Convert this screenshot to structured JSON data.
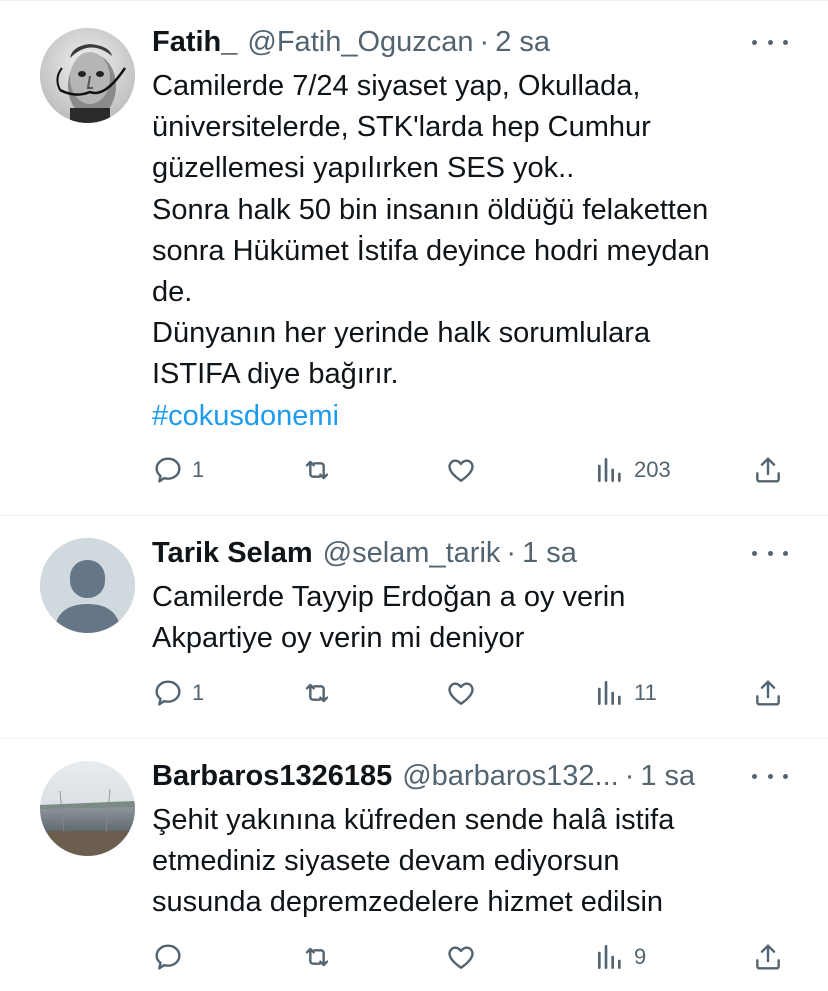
{
  "tweets": [
    {
      "name": "Fatih_",
      "handle": "@Fatih_Oguzcan",
      "dot": "·",
      "time": "2 sa",
      "avatar": "portrait-avatar",
      "lines": [
        "Camilerde 7/24 siyaset yap, Okullada,",
        "üniversitelerde, STK'larda hep Cumhur",
        "güzellemesi yapılırken SES yok..",
        "Sonra halk 50 bin insanın öldüğü felaketten",
        "sonra Hükümet İstifa deyince hodri meydan",
        "de.",
        "Dünyanın her yerinde halk sorumlulara",
        "ISTIFA diye bağırır."
      ],
      "hashtag": "#cokusdonemi",
      "replies": "1",
      "retweets": "",
      "likes": "",
      "views": "203"
    },
    {
      "name": "Tarik Selam",
      "handle": "@selam_tarik",
      "dot": "·",
      "time": "1 sa",
      "avatar": "default-avatar",
      "lines": [
        "Camilerde Tayyip Erdoğan a oy verin",
        "Akpartiye oy verin mi deniyor"
      ],
      "replies": "1",
      "retweets": "",
      "likes": "",
      "views": "11"
    },
    {
      "name": "Barbaros1326185",
      "handle": "@barbaros132...",
      "dot": "·",
      "time": "1 sa",
      "avatar": "landscape-avatar",
      "lines": [
        "Şehit yakınına küfreden sende halâ istifa",
        "etmediniz siyasete devam ediyorsun",
        "susunda depremzedelere hizmet edilsin"
      ],
      "replies": "",
      "retweets": "",
      "likes": "",
      "views": "9"
    }
  ],
  "icons": {
    "reply": "reply-icon",
    "retweet": "retweet-icon",
    "like": "heart-icon",
    "views": "views-icon",
    "share": "share-icon",
    "more": "more-options-icon"
  },
  "colors": {
    "text": "#0f1419",
    "secondary": "#536471",
    "link": "#1d9bf0",
    "divider": "#eff3f4"
  }
}
